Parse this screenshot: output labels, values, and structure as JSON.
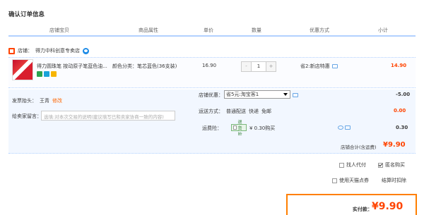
{
  "page_title": "确认订单信息",
  "columns": [
    "店铺宝贝",
    "商品属性",
    "单价",
    "数量",
    "优惠方式",
    "小计"
  ],
  "shop": {
    "label": "店铺：",
    "name": "得力中科创意专卖店"
  },
  "item": {
    "name": "得力圆珠笔 按动原子笔蓝色油...",
    "sku": "颜色分类：笔芯蓝色(36支装)",
    "price": "16.90",
    "quantity": "1",
    "qty_minus": "-",
    "qty_plus": "+",
    "discount": "省2:新店特惠",
    "subtotal": "14.90"
  },
  "invoice": {
    "label": "发票抬头：",
    "name": "王青",
    "edit": "修改"
  },
  "message": {
    "label": "给卖家留言：",
    "placeholder": "选填:对本次交易的说明(建议填写已和卖家协商一致的内容)"
  },
  "shop_promo": {
    "label": "店铺优惠：",
    "selected": "省5元:淘宝客1",
    "amount": "-5.00"
  },
  "shipping": {
    "label": "运送方式：",
    "options": [
      "普通配送",
      "快递",
      "免邮"
    ],
    "amount": "0.00"
  },
  "insurance": {
    "label": "运费险：",
    "badge": "退货险",
    "text": "¥ 0.30购买",
    "amount": "0.30"
  },
  "shop_total": {
    "label": "店铺合计(含运费)",
    "value": "¥9.90"
  },
  "options": {
    "proxy_pay": "找人代付",
    "anonymous": "匿名购买",
    "tmall_points": "使用天猫点券",
    "points_rule": "结算时扣除"
  },
  "grand_total": {
    "label": "实付款：",
    "value": "¥9.90"
  },
  "colors": {
    "accent": "#ff4400",
    "header_line": "#b2d1ff",
    "panel_bg": "#f2f7ff",
    "total_border": "#ff7f00"
  }
}
